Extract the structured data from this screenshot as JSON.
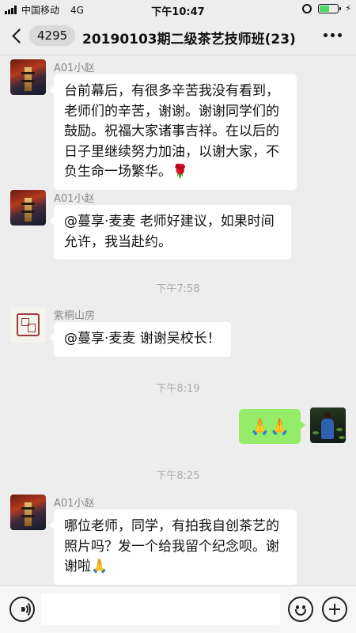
{
  "status_bar": {
    "carrier": "中国移动",
    "network": "4G",
    "time": "下午10:47",
    "battery_level": 0.55,
    "battery_color": "#4cd964"
  },
  "nav": {
    "back_icon": "chevron-left-icon",
    "unread_count": "4295",
    "title": "20190103期二级茶艺技师班(23)",
    "more_icon": "more-dots-icon"
  },
  "messages": [
    {
      "sender": "A01小赵",
      "avatar": "pagoda-autumn-avatar",
      "text": "台前幕后，有很多辛苦我没有看到，老师们的辛苦，谢谢。谢谢同学们的鼓励。祝福大家诸事吉祥。在以后的日子里继续努力加油，以谢大家，不负生命一场繁华。🌹"
    },
    {
      "sender": "A01小赵",
      "avatar": "pagoda-autumn-avatar",
      "text": "@蔓享·麦麦 老师好建议，如果时间允许，我当赴约。"
    },
    {
      "time": "下午7:58"
    },
    {
      "sender": "紫桐山房",
      "avatar": "seal-avatar",
      "text": "@蔓享·麦麦 谢谢吴校长！"
    },
    {
      "time": "下午8:19"
    },
    {
      "self": true,
      "avatar": "tea-garden-avatar",
      "text": "🙏🙏"
    },
    {
      "time": "下午8:25"
    },
    {
      "sender": "A01小赵",
      "avatar": "pagoda-autumn-avatar",
      "text": "哪位老师，同学，有拍我自创茶艺的照片吗？发一个给我留个纪念呗。谢谢啦🙏"
    }
  ],
  "colors": {
    "background": "#ededed",
    "self_bubble": "#95ec69",
    "other_bubble": "#ffffff"
  },
  "input_bar": {
    "voice_icon": "voice-icon",
    "text_value": "",
    "emoji_icon": "emoji-icon",
    "plus_icon": "plus-icon"
  }
}
